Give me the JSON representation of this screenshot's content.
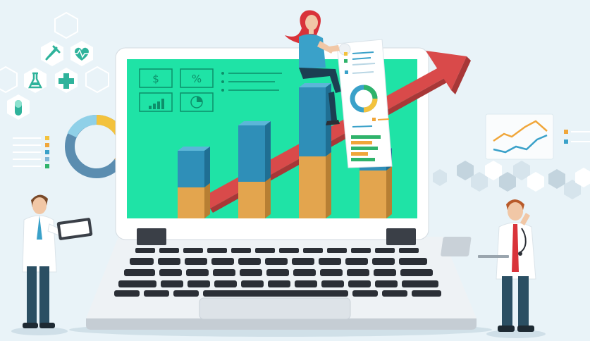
{
  "screen_icons": {
    "dollar": "$",
    "percent": "%"
  },
  "colors": {
    "background": "#e9f3f8",
    "screen": "#1fe3a6",
    "bar_top": "#2f8fb8",
    "bar_bottom": "#e3a54e",
    "arrow": "#d94a4a",
    "laptop_frame": "#eef2f5",
    "keys": "#2b2f36",
    "doctor_coat": "#ffffff",
    "woman_shirt": "#3aa1c9",
    "woman_hair": "#d9333a"
  },
  "icons": [
    "syringe-icon",
    "heart-pulse-icon",
    "flask-icon",
    "medical-cross-icon",
    "pill-icon",
    "dollar-icon",
    "percent-icon",
    "bar-chart-icon",
    "pie-chart-icon",
    "donut-chart-icon",
    "line-chart-icon",
    "tablet-icon",
    "laptop-icon"
  ]
}
